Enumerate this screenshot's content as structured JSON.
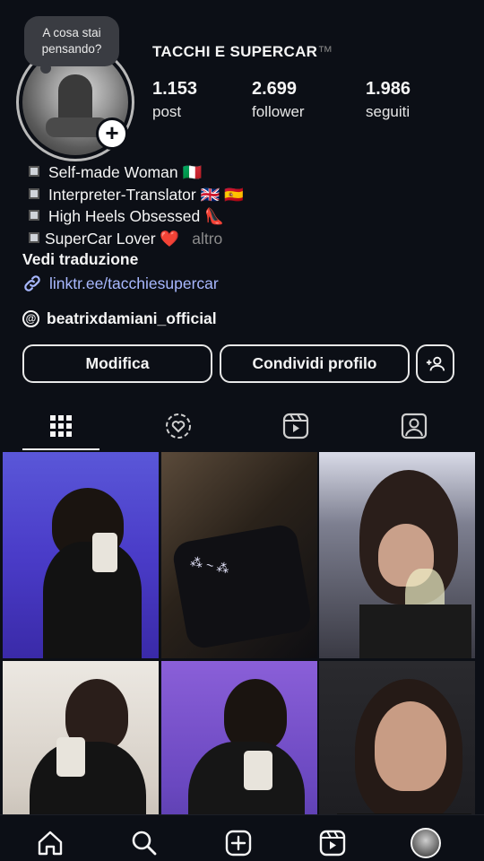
{
  "note": {
    "text": "A cosa stai pensando?"
  },
  "profile": {
    "username": "TACCHI E SUPERCAR",
    "trademark": "™",
    "stats": [
      {
        "value": "1.153",
        "label": "post"
      },
      {
        "value": "2.699",
        "label": "follower"
      },
      {
        "value": "1.986",
        "label": "seguiti"
      }
    ]
  },
  "bio": {
    "lines": [
      {
        "text": "Self-made Woman",
        "emoji": "🇮🇹"
      },
      {
        "text": "Interpreter-Translator",
        "emoji": "🇬🇧 🇪🇸"
      },
      {
        "text": "High Heels Obsessed",
        "emoji": "👠"
      },
      {
        "text": "SuperCar Lover",
        "emoji": "❤️"
      }
    ],
    "more_label": "altro",
    "translate_label": "Vedi traduzione",
    "link": "linktr.ee/tacchiesupercar",
    "threads_handle": "beatrixdamiani_official"
  },
  "buttons": {
    "edit": "Modifica",
    "share": "Condividi profilo"
  },
  "tabs": [
    "grid-icon",
    "collab-heart-icon",
    "reels-icon",
    "tagged-icon"
  ],
  "nav": [
    "home-icon",
    "search-icon",
    "create-icon",
    "reels-icon",
    "profile-avatar"
  ],
  "colors": {
    "background": "#0c0f16",
    "link": "#a8b8ff",
    "muted": "#8c8c8c"
  }
}
